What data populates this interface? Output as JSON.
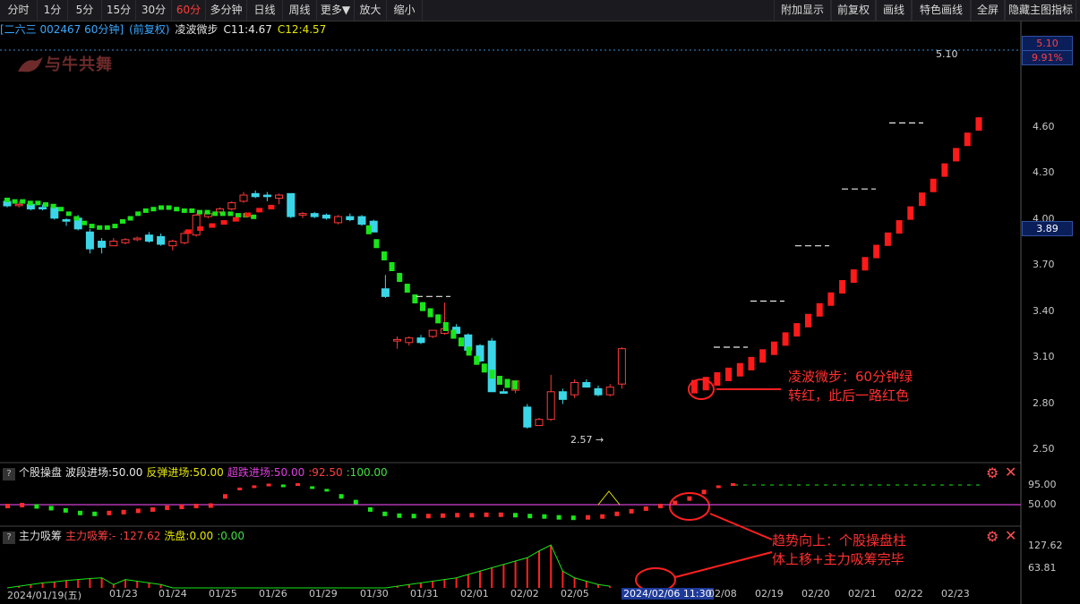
{
  "toolbar": {
    "left": [
      "分时",
      "1分",
      "5分",
      "15分",
      "30分",
      "60分",
      "多分钟",
      "日线",
      "周线",
      "更多▼",
      "放大",
      "缩小"
    ],
    "active": "60分",
    "right": [
      "附加显示",
      "前复权",
      "画线",
      "特色画线",
      "全屏",
      "隐藏主图指标"
    ]
  },
  "header": {
    "stock": "[二六三 002467 60分钟]",
    "adjust": "(前复权)",
    "indicator": "凌波微步",
    "c11": "C11:4.67",
    "c12": "C12:4.57"
  },
  "logo": {
    "text": "与牛共舞"
  },
  "price_axis": {
    "ticks": [
      "4.60",
      "4.30",
      "4.00",
      "3.70",
      "3.40",
      "3.10",
      "2.80",
      "2.50"
    ],
    "high_tag": "5.10",
    "high_pct": "9.91%",
    "current": "3.89",
    "high_label": "5.10",
    "low_label": "2.57"
  },
  "osc_panel": {
    "name": "个股操盘",
    "items": [
      {
        "text": "波段进场:50.00",
        "color": "#e8e8e8"
      },
      {
        "text": "反弹进场:50.00",
        "color": "#e8e800"
      },
      {
        "text": "超跌进场:50.00",
        "color": "#e040e0"
      },
      {
        "text": ":92.50",
        "color": "#ff4040"
      },
      {
        "text": ":100.00",
        "color": "#40e040"
      }
    ],
    "ticks": [
      "95.00",
      "50.00"
    ]
  },
  "chip_panel": {
    "name": "主力吸筹",
    "items": [
      {
        "text": "主力吸筹:-",
        "color": "#ff4040"
      },
      {
        "text": ":127.62",
        "color": "#ff4040"
      },
      {
        "text": "洗盘:0.00",
        "color": "#e8e800"
      },
      {
        "text": ":0.00",
        "color": "#40e040"
      }
    ],
    "ticks": [
      "127.62",
      "63.81"
    ]
  },
  "dates": [
    "2024/01/19(五)",
    "01/23",
    "01/24",
    "01/25",
    "01/26",
    "01/29",
    "01/30",
    "01/31",
    "02/01",
    "02/02",
    "02/05",
    "2024/02/06 11:30",
    "02/08",
    "02/19",
    "02/20",
    "02/21",
    "02/22",
    "02/23"
  ],
  "annotations": {
    "main": [
      "凌波微步：60分钟绿",
      "转红，此后一路红色"
    ],
    "sub": [
      "趋势向上：个股操盘柱",
      "体上移+主力吸筹完毕"
    ]
  },
  "chart_data": {
    "type": "candlestick",
    "candles": [
      {
        "o": 4.12,
        "h": 4.14,
        "l": 4.08,
        "c": 4.09
      },
      {
        "o": 4.1,
        "h": 4.12,
        "l": 4.08,
        "c": 4.1
      },
      {
        "o": 4.1,
        "h": 4.11,
        "l": 4.06,
        "c": 4.07
      },
      {
        "o": 4.08,
        "h": 4.1,
        "l": 4.06,
        "c": 4.07
      },
      {
        "o": 4.08,
        "h": 4.1,
        "l": 4.0,
        "c": 4.01
      },
      {
        "o": 4.0,
        "h": 4.01,
        "l": 3.96,
        "c": 3.99
      },
      {
        "o": 4.01,
        "h": 4.03,
        "l": 3.93,
        "c": 3.94
      },
      {
        "o": 3.92,
        "h": 3.94,
        "l": 3.78,
        "c": 3.81
      },
      {
        "o": 3.86,
        "h": 3.88,
        "l": 3.78,
        "c": 3.82
      },
      {
        "o": 3.83,
        "h": 3.88,
        "l": 3.83,
        "c": 3.86
      },
      {
        "o": 3.85,
        "h": 3.88,
        "l": 3.84,
        "c": 3.87
      },
      {
        "o": 3.87,
        "h": 3.89,
        "l": 3.86,
        "c": 3.88
      },
      {
        "o": 3.9,
        "h": 3.92,
        "l": 3.85,
        "c": 3.86
      },
      {
        "o": 3.89,
        "h": 3.91,
        "l": 3.83,
        "c": 3.84
      },
      {
        "o": 3.83,
        "h": 3.87,
        "l": 3.8,
        "c": 3.86
      },
      {
        "o": 3.85,
        "h": 3.93,
        "l": 3.84,
        "c": 3.91
      },
      {
        "o": 3.9,
        "h": 4.04,
        "l": 3.89,
        "c": 4.03
      },
      {
        "o": 4.02,
        "h": 4.05,
        "l": 4.01,
        "c": 4.04
      },
      {
        "o": 4.05,
        "h": 4.08,
        "l": 4.04,
        "c": 4.07
      },
      {
        "o": 4.07,
        "h": 4.12,
        "l": 4.06,
        "c": 4.11
      },
      {
        "o": 4.12,
        "h": 4.18,
        "l": 4.11,
        "c": 4.16
      },
      {
        "o": 4.17,
        "h": 4.19,
        "l": 4.14,
        "c": 4.15
      },
      {
        "o": 4.16,
        "h": 4.18,
        "l": 4.12,
        "c": 4.15
      },
      {
        "o": 4.14,
        "h": 4.17,
        "l": 4.1,
        "c": 4.16
      },
      {
        "o": 4.17,
        "h": 4.17,
        "l": 4.01,
        "c": 4.02
      },
      {
        "o": 4.03,
        "h": 4.05,
        "l": 4.01,
        "c": 4.04
      },
      {
        "o": 4.04,
        "h": 4.05,
        "l": 4.01,
        "c": 4.02
      },
      {
        "o": 4.03,
        "h": 4.04,
        "l": 4.0,
        "c": 4.01
      },
      {
        "o": 3.98,
        "h": 4.03,
        "l": 3.97,
        "c": 4.02
      },
      {
        "o": 4.02,
        "h": 4.04,
        "l": 3.99,
        "c": 4.0
      },
      {
        "o": 4.02,
        "h": 4.03,
        "l": 3.96,
        "c": 3.97
      },
      {
        "o": 3.99,
        "h": 4.0,
        "l": 3.92,
        "c": 3.92
      },
      {
        "o": 3.55,
        "h": 3.64,
        "l": 3.49,
        "c": 3.5
      },
      {
        "o": 3.21,
        "h": 3.24,
        "l": 3.16,
        "c": 3.22
      },
      {
        "o": 3.2,
        "h": 3.24,
        "l": 3.18,
        "c": 3.23
      },
      {
        "o": 3.23,
        "h": 3.25,
        "l": 3.19,
        "c": 3.2
      },
      {
        "o": 3.24,
        "h": 3.28,
        "l": 3.23,
        "c": 3.28
      },
      {
        "o": 3.26,
        "h": 3.46,
        "l": 3.25,
        "c": 3.29
      },
      {
        "o": 3.3,
        "h": 3.32,
        "l": 3.26,
        "c": 3.26
      },
      {
        "o": 3.25,
        "h": 3.26,
        "l": 3.13,
        "c": 3.15
      },
      {
        "o": 3.18,
        "h": 3.19,
        "l": 3.07,
        "c": 3.08
      },
      {
        "o": 3.21,
        "h": 3.23,
        "l": 2.88,
        "c": 2.88
      },
      {
        "o": 2.88,
        "h": 2.9,
        "l": 2.87,
        "c": 2.87
      },
      {
        "o": 2.89,
        "h": 2.95,
        "l": 2.87,
        "c": 2.95
      },
      {
        "o": 2.78,
        "h": 2.8,
        "l": 2.64,
        "c": 2.65
      },
      {
        "o": 2.66,
        "h": 2.71,
        "l": 2.66,
        "c": 2.7
      },
      {
        "o": 2.7,
        "h": 2.99,
        "l": 2.69,
        "c": 2.88
      },
      {
        "o": 2.88,
        "h": 2.9,
        "l": 2.8,
        "c": 2.83
      },
      {
        "o": 2.86,
        "h": 2.96,
        "l": 2.84,
        "c": 2.94
      },
      {
        "o": 2.94,
        "h": 2.96,
        "l": 2.91,
        "c": 2.91
      },
      {
        "o": 2.9,
        "h": 2.92,
        "l": 2.85,
        "c": 2.86
      },
      {
        "o": 2.86,
        "h": 2.93,
        "l": 2.85,
        "c": 2.91
      },
      {
        "o": 2.93,
        "h": 3.17,
        "l": 2.9,
        "c": 3.16
      }
    ],
    "low_point": 2.57,
    "lbwb_green": [
      4.12,
      4.11,
      4.11,
      4.1,
      4.1,
      4.09,
      4.08,
      4.06,
      4.03,
      4.0,
      3.97,
      3.95,
      3.94,
      3.94,
      3.95,
      3.98,
      4.0,
      4.03,
      4.05,
      4.06,
      4.07,
      4.07,
      4.06,
      4.05,
      4.05,
      4.04,
      4.04,
      4.03,
      4.03,
      4.03,
      4.02,
      4.02,
      4.01,
      3.94,
      3.85,
      3.77,
      3.7,
      3.63,
      3.56,
      3.49,
      3.44,
      3.4,
      3.36,
      3.31,
      3.26,
      3.21,
      3.15,
      3.09,
      3.04,
      3.0,
      2.96,
      2.94,
      2.93,
      2.92,
      2.92,
      2.91
    ],
    "lbwb_red": [
      3.89,
      3.91,
      3.93,
      3.95,
      3.97,
      4.0,
      4.03,
      4.05,
      2.91,
      2.93,
      2.96,
      2.99,
      3.02,
      3.06,
      3.11,
      3.16,
      3.22,
      3.28,
      3.34,
      3.41,
      3.48,
      3.56,
      3.63,
      3.71,
      3.79,
      3.87,
      3.95,
      4.04,
      4.13,
      4.22,
      4.32,
      4.42,
      4.52,
      4.62
    ],
    "step_levels": [
      3.5,
      3.17,
      3.47,
      3.83,
      4.2,
      4.63
    ],
    "osc_values": [
      48,
      50,
      47,
      43,
      38,
      32,
      30,
      32,
      34,
      37,
      40,
      44,
      46,
      48,
      49,
      70,
      85,
      90,
      94,
      92,
      95,
      88,
      82,
      70,
      57,
      40,
      30,
      26,
      25,
      25,
      26,
      27,
      27,
      28,
      28,
      27,
      25,
      24,
      22,
      21,
      22,
      24,
      30,
      36,
      42,
      48,
      55,
      65,
      80,
      90,
      95
    ],
    "osc_ref": 50,
    "chip_values": [
      0,
      5,
      10,
      15,
      18,
      22,
      25,
      28,
      30,
      10,
      25,
      20,
      15,
      10,
      0,
      0,
      0,
      0,
      0,
      0,
      0,
      0,
      0,
      0,
      0,
      0,
      0,
      0,
      0,
      0,
      0,
      0,
      0,
      5,
      10,
      15,
      20,
      25,
      30,
      40,
      50,
      60,
      70,
      80,
      90,
      110,
      128,
      50,
      30,
      20,
      10,
      5
    ]
  }
}
